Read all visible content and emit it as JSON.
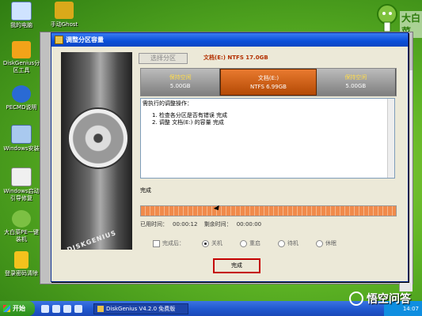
{
  "desktop": {
    "icons": [
      "我的电脑",
      "DiskGenius分区工具",
      "PECMD说明",
      "Windows安装",
      "Windows启动引导修复",
      "大白菜PE一键装机",
      "登录密码清除"
    ],
    "top_icon": "手动Ghost",
    "logo_text": "大白菜"
  },
  "dialog": {
    "title": "调整分区容量",
    "top_button": "选择分区",
    "doc_info": "文档(E:) NTFS 17.0GB",
    "partitions": [
      {
        "name": "保持空闲",
        "size": "5.00GB"
      },
      {
        "name": "文档(E:)",
        "size": "NTFS 6.99GB"
      },
      {
        "name": "保持空闲",
        "size": "5.00GB"
      }
    ],
    "log_header": "需执行的调整操作：",
    "log_lines": [
      "1. 检查各分区是否有错误    完成",
      "2. 调整 文档(E:) 的容量    完成"
    ],
    "status": "完成",
    "progress_percent": 100,
    "elapsed_label": "已用时间：",
    "elapsed": "00:00:12",
    "remain_label": "剩余时间：",
    "remain": "00:00:00",
    "after_label": "完成后：",
    "options": [
      "关机",
      "重启",
      "待机",
      "休眠"
    ],
    "done_button": "完成"
  },
  "taskbar": {
    "start": "开始",
    "task": "DiskGenius V4.2.0 免费版",
    "clock": "14:07"
  },
  "watermark": "悟空问答"
}
